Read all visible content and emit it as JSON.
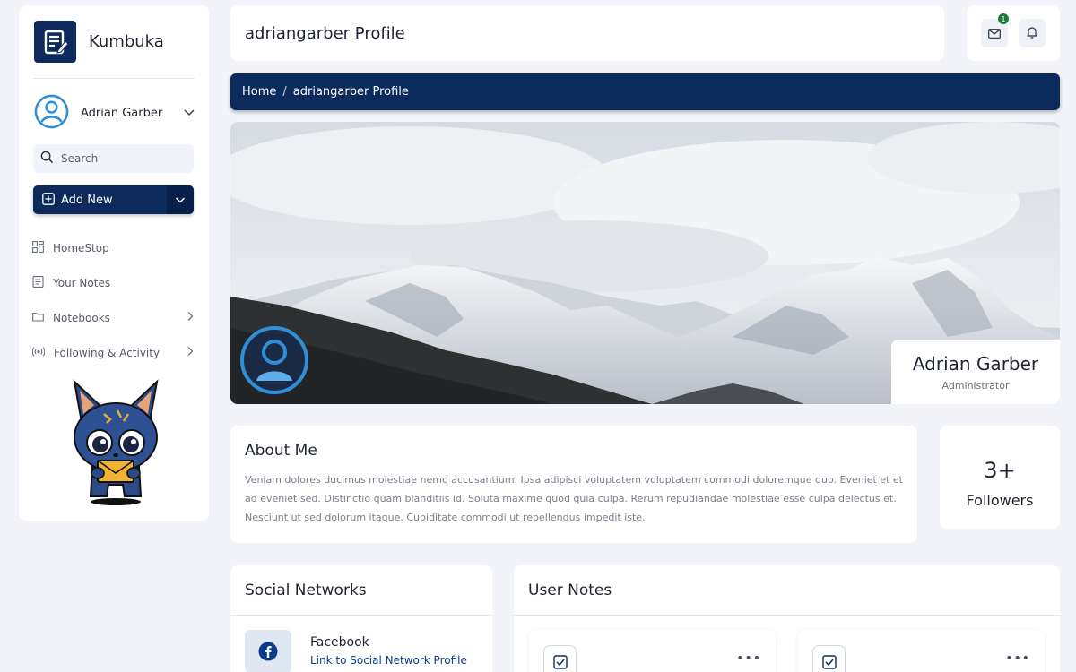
{
  "brand": {
    "name": "Kumbuka"
  },
  "user": {
    "name": "Adrian Garber"
  },
  "search": {
    "placeholder": "Search"
  },
  "add_new": {
    "label": "Add New"
  },
  "nav": [
    {
      "label": "HomeStop",
      "icon": "grid-icon"
    },
    {
      "label": "Your Notes",
      "icon": "note-icon"
    },
    {
      "label": "Notebooks",
      "icon": "folder-icon"
    },
    {
      "label": "Following & Activity",
      "icon": "broadcast-icon"
    }
  ],
  "header": {
    "title": "adriangarber Profile",
    "mail_badge": "1"
  },
  "breadcrumb": {
    "home": "Home",
    "separator": "/",
    "current": "adriangarber Profile"
  },
  "profile": {
    "name": "Adrian Garber",
    "role": "Administrator"
  },
  "about": {
    "title": "About Me",
    "text": "Veniam dolores ducimus molestiae nemo accusantium. Ipsa adipisci voluptatem voluptatem commodi doloremque quo. Eveniet et et ad eveniet sed. Distinctio quam blanditiis id. Soluta maxime quod quia culpa. Rerum repudiandae molestiae esse culpa delectus et. Nesciunt ut sed dolorum itaque. Cupiditate commodi ut repellendus impedit iste."
  },
  "followers": {
    "count": "3+",
    "label": "Followers"
  },
  "social": {
    "title": "Social Networks",
    "items": [
      {
        "name": "Facebook",
        "link": "Link to Social Network Profile"
      }
    ]
  },
  "notes": {
    "title": "User Notes"
  },
  "colors": {
    "primary": "#0d2a5c",
    "accent": "#2f8ed8",
    "badge": "#1f7a3a"
  }
}
